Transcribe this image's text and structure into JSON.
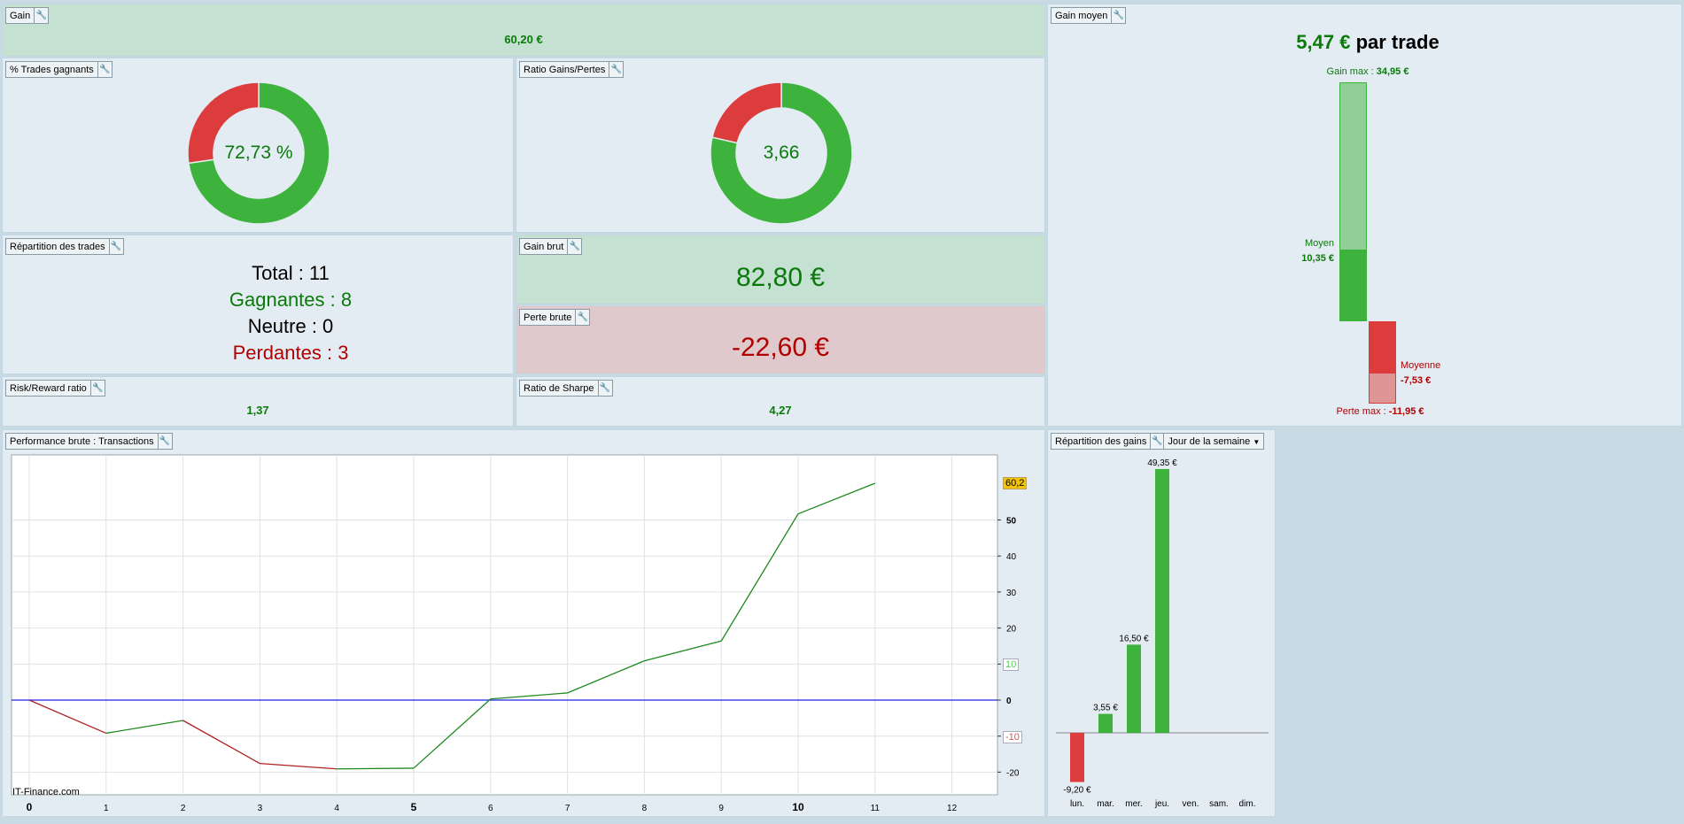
{
  "gain": {
    "title": "Gain",
    "value": "60,20 €"
  },
  "win_pct": {
    "title": "% Trades gagnants",
    "value": "72,73 %",
    "fraction": 0.7273
  },
  "ratio": {
    "title": "Ratio Gains/Pertes",
    "value": "3,66",
    "fraction": 0.786
  },
  "repartition": {
    "title": "Répartition des trades",
    "total": "Total : 11",
    "gagnantes": "Gagnantes : 8",
    "neutre": "Neutre : 0",
    "perdantes": "Perdantes : 3"
  },
  "gain_brut": {
    "title": "Gain brut",
    "value": "82,80 €"
  },
  "perte_brute": {
    "title": "Perte brute",
    "value": "-22,60 €"
  },
  "risk_reward": {
    "title": "Risk/Reward ratio",
    "value": "1,37"
  },
  "sharpe": {
    "title": "Ratio de Sharpe",
    "value": "4,27"
  },
  "gain_moyen": {
    "title": "Gain moyen",
    "amount": "5,47 €",
    "suffix": " par trade",
    "gain_max_label": "Gain max : ",
    "gain_max": "34,95 €",
    "moyen_label": "Moyen",
    "moyen": "10,35 €",
    "moyenne_label": "Moyenne",
    "moyenne": "-7,53 €",
    "perte_max_label": "Perte max : ",
    "perte_max": "-11,95 €"
  },
  "performance": {
    "title": "Performance brute : Transactions",
    "watermark": "IT-Finance.com",
    "last_label": "60,2",
    "marker_pos": "10",
    "marker_neg": "-10"
  },
  "gains_dist": {
    "title": "Répartition des gains",
    "selector": "Jour de la semaine"
  },
  "chart_data": [
    {
      "type": "line",
      "title": "Performance brute : Transactions",
      "x": [
        0,
        1,
        2,
        3,
        4,
        5,
        6,
        7,
        8,
        9,
        10,
        11
      ],
      "y": [
        0,
        -9.2,
        -5.65,
        -17.6,
        -19.1,
        -18.9,
        0.3,
        2.0,
        10.9,
        16.4,
        51.7,
        60.2
      ],
      "xlim": [
        0,
        12
      ],
      "ylim": [
        -25,
        65
      ],
      "yticks": [
        -20,
        -10,
        0,
        10,
        20,
        30,
        40,
        50
      ],
      "xticks": [
        0,
        1,
        2,
        3,
        4,
        5,
        6,
        7,
        8,
        9,
        10,
        11,
        12
      ],
      "grid": true
    },
    {
      "type": "bar",
      "title": "Répartition des gains",
      "categories": [
        "lun.",
        "mar.",
        "mer.",
        "jeu.",
        "ven.",
        "sam.",
        "dim."
      ],
      "values": [
        -9.2,
        3.55,
        16.5,
        49.35,
        null,
        null,
        null
      ],
      "labels": [
        "-9,20 €",
        "3,55 €",
        "16,50 €",
        "49,35 €",
        "",
        "",
        ""
      ]
    }
  ],
  "colors": {
    "green": "#3db33d",
    "red": "#dd3c3c",
    "text_green": "#0a7a0a",
    "text_red": "#b00000"
  }
}
